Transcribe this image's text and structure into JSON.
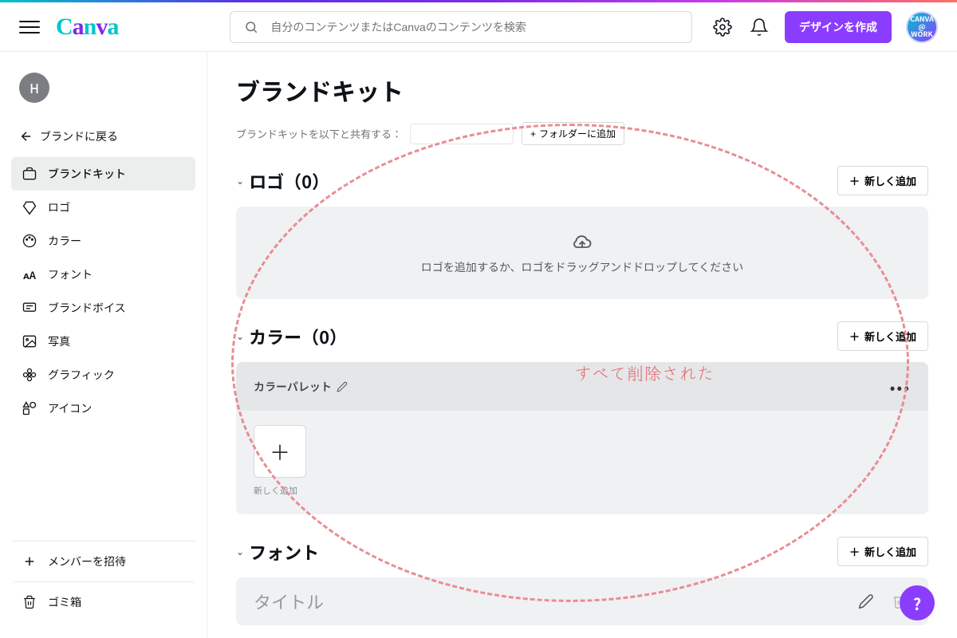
{
  "header": {
    "logo_text": "Canva",
    "search_placeholder": "自分のコンテンツまたはCanvaのコンテンツを検索",
    "create_button": "デザインを作成",
    "badge_text": "CANVA @ WORK"
  },
  "sidebar": {
    "user_initial": "H",
    "back_label": "ブランドに戻る",
    "items": [
      {
        "label": "ブランドキット",
        "icon": "briefcase-icon",
        "active": true
      },
      {
        "label": "ロゴ",
        "icon": "co-icon",
        "active": false
      },
      {
        "label": "カラー",
        "icon": "palette-icon",
        "active": false
      },
      {
        "label": "フォント",
        "icon": "font-icon",
        "active": false
      },
      {
        "label": "ブランドボイス",
        "icon": "chat-icon",
        "active": false
      },
      {
        "label": "写真",
        "icon": "image-icon",
        "active": false
      },
      {
        "label": "グラフィック",
        "icon": "flower-icon",
        "active": false
      },
      {
        "label": "アイコン",
        "icon": "shapes-icon",
        "active": false
      }
    ],
    "invite_label": "メンバーを招待",
    "trash_label": "ゴミ箱"
  },
  "main": {
    "page_title": "ブランドキット",
    "share_label": "ブランドキットを以下と共有する：",
    "folder_button": "フォルダーに追加",
    "sections": {
      "logo": {
        "title": "ロゴ（0）",
        "add_button": "新しく追加",
        "dropzone_text": "ロゴを追加するか、ロゴをドラッグアンドドロップしてください"
      },
      "color": {
        "title": "カラー（0）",
        "add_button": "新しく追加",
        "palette_name": "カラーパレット",
        "add_tile_label": "新しく追加"
      },
      "font": {
        "title": "フォント",
        "add_button": "新しく追加",
        "title_row_label": "タイトル"
      }
    }
  },
  "annotation": {
    "text": "すべて削除された"
  }
}
